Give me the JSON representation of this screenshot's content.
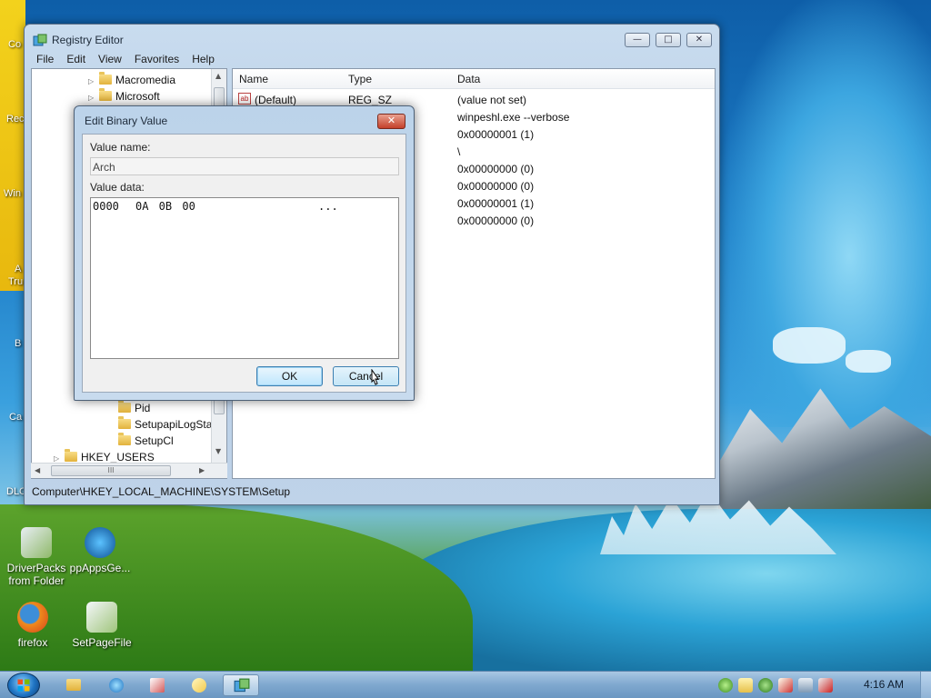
{
  "desktop": {
    "icons": [
      {
        "label": "DriverPacks from Folder",
        "line1": "DriverPacks",
        "line2": "from Folder",
        "icon": "driverpacks-icon"
      },
      {
        "label": "ppAppsGe...",
        "icon": "ppappsge-icon"
      },
      {
        "label": "firefox",
        "icon": "firefox-icon"
      },
      {
        "label": "SetPageFile",
        "icon": "setpagefile-icon"
      }
    ],
    "partial_labels": [
      "Co",
      "Rec",
      "Win",
      "A",
      "Tru",
      "B",
      "Ca",
      "DLC"
    ]
  },
  "regedit": {
    "title": "Registry Editor",
    "menu": [
      "File",
      "Edit",
      "View",
      "Favorites",
      "Help"
    ],
    "tree": [
      {
        "label": "Macromedia"
      },
      {
        "label": "Microsoft"
      },
      {
        "label": "Pid"
      },
      {
        "label": "SetupapiLogSta"
      },
      {
        "label": "SetupCl"
      },
      {
        "label": "HKEY_USERS"
      }
    ],
    "columns": {
      "name": "Name",
      "type": "Type",
      "data": "Data"
    },
    "rows": [
      {
        "name": "(Default)",
        "type": "REG_SZ",
        "data": "(value not set)"
      },
      {
        "name": "",
        "type": "",
        "data": "winpeshl.exe --verbose"
      },
      {
        "name": "",
        "type": "",
        "data": "0x00000001 (1)"
      },
      {
        "name": "",
        "type": "",
        "data": "\\"
      },
      {
        "name": "",
        "type": "",
        "data": "0x00000000 (0)"
      },
      {
        "name": "",
        "type": "",
        "data": "0x00000000 (0)"
      },
      {
        "name": "",
        "type": "",
        "data": "0x00000001 (1)"
      },
      {
        "name": "",
        "type": "",
        "data": "0x00000000 (0)"
      }
    ],
    "hscroll_thumb": "III",
    "status": "Computer\\HKEY_LOCAL_MACHINE\\SYSTEM\\Setup"
  },
  "dialog": {
    "title": "Edit Binary Value",
    "close_glyph": "✕",
    "value_name_label": "Value name:",
    "value_name": "Arch",
    "value_data_label": "Value data:",
    "hex_offset": "0000",
    "hex_bytes": "0A 0B 00",
    "hex_ascii": "...",
    "ok_label": "OK",
    "cancel_label": "Cancel"
  },
  "taskbar": {
    "clock": "4:16 AM",
    "items": [
      "explorer-icon",
      "ie-icon",
      "network-icon",
      "paint-icon",
      "regedit-icon"
    ],
    "tray_icons": [
      "security-icon",
      "notes-icon",
      "play-icon",
      "tools-icon",
      "network-tray-icon",
      "volume-mute-icon"
    ]
  },
  "colors": {
    "titlebar": "#bfd3e9",
    "close_button": "#c4402a",
    "taskbar": "#7fa8cf"
  }
}
